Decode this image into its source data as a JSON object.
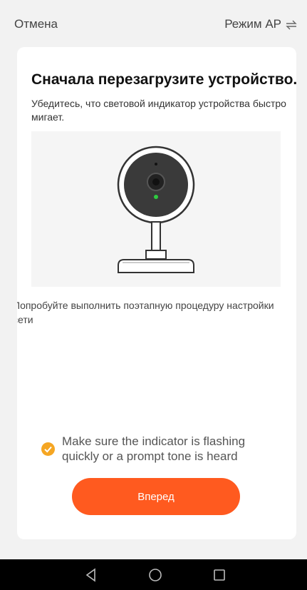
{
  "header": {
    "cancel_label": "Отмена",
    "mode_label": "Режим AP"
  },
  "card": {
    "title": "Сначала перезагрузите устройство.",
    "subtitle": "Убедитесь, что световой индикатор устройства быстро мигает.",
    "try_link": "Попробуйте выполнить поэтапную процедуру настройки сети",
    "confirm_text": "Make sure the indicator is flashing quickly or a prompt tone is heard",
    "next_button": "Вперед"
  },
  "colors": {
    "accent": "#ff5a1f",
    "check": "#f5a623",
    "led": "#2ecc40"
  }
}
